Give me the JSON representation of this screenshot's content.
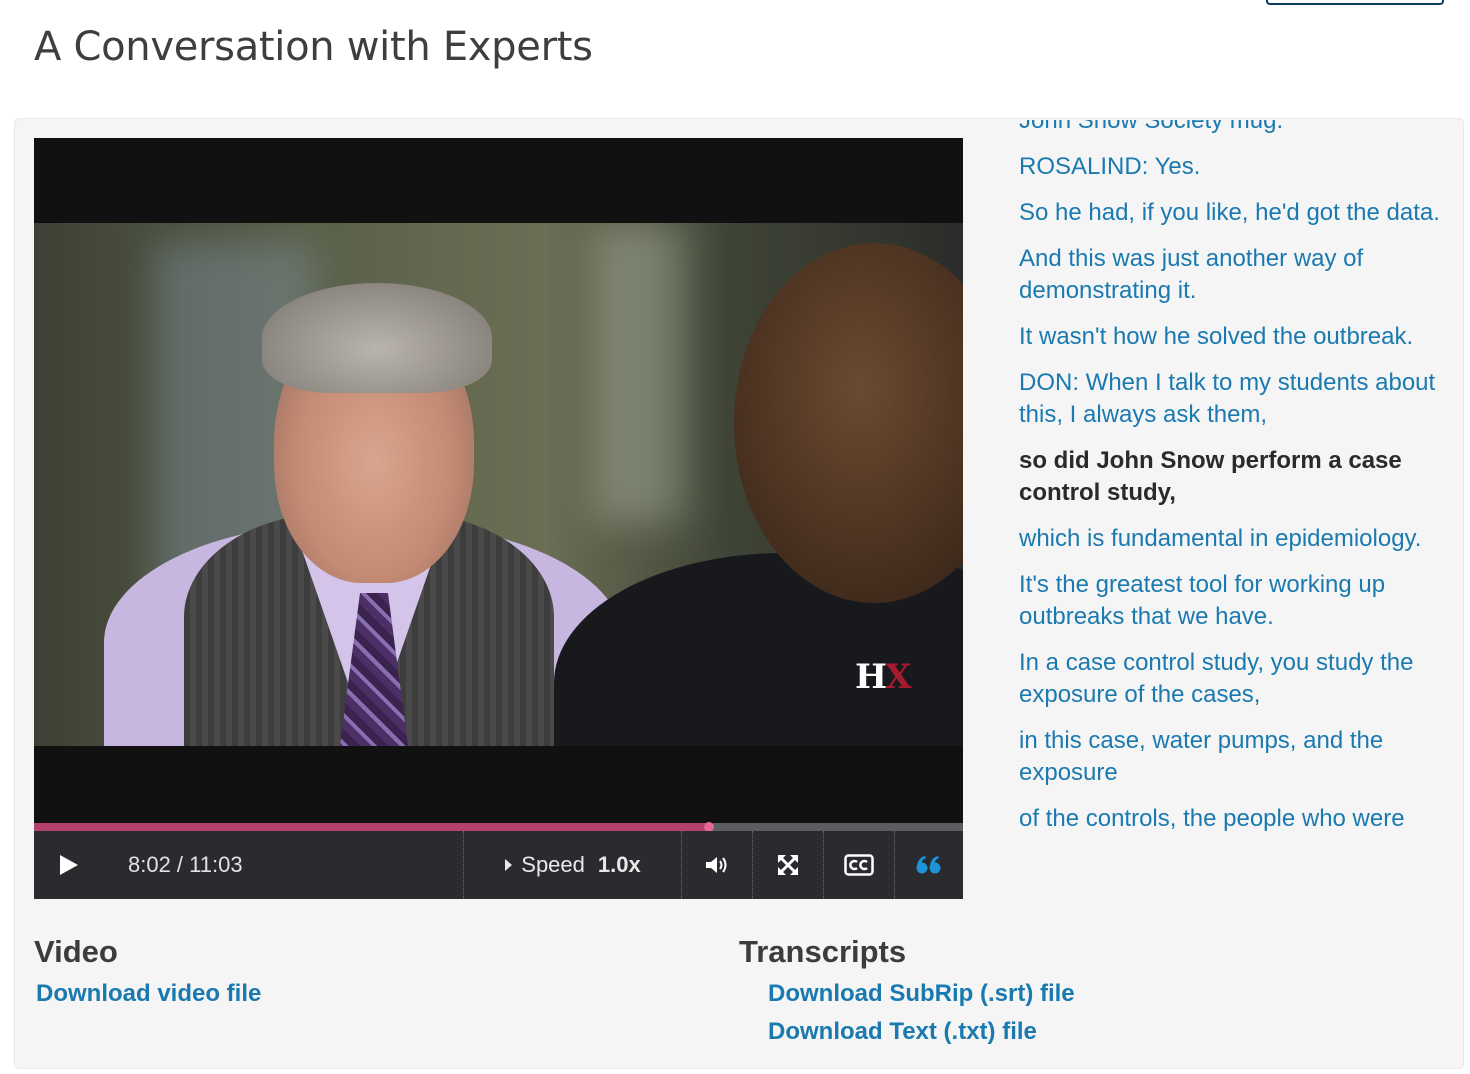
{
  "page": {
    "title": "A Conversation with Experts"
  },
  "player": {
    "logo_h": "H",
    "logo_x": "X",
    "time_display": "8:02 / 11:03",
    "progress_fraction": 0.7263,
    "speed_label": "Speed",
    "speed_value": "1.0x",
    "icons": {
      "play": "play-icon",
      "volume": "volume-icon",
      "fullscreen": "fullscreen-icon",
      "captions": "cc-icon",
      "transcript_toggle": "quote-icon"
    },
    "colors": {
      "progress": "#b2416b",
      "handle": "#e46799",
      "transcript_toggle": "#1e93d8"
    }
  },
  "transcript": {
    "lines": [
      {
        "text": "John Snow Society mug.",
        "active": false
      },
      {
        "text": "ROSALIND: Yes.",
        "active": false
      },
      {
        "text": "So he had, if you like, he'd got the data.",
        "active": false
      },
      {
        "text": "And this was just another way of demonstrating it.",
        "active": false
      },
      {
        "text": "It wasn't how he solved the outbreak.",
        "active": false
      },
      {
        "text": "DON: When I talk to my students about this, I always ask them,",
        "active": false
      },
      {
        "text": "so did John Snow perform a case control study,",
        "active": true
      },
      {
        "text": "which is fundamental in epidemiology.",
        "active": false
      },
      {
        "text": "It's the greatest tool for working up outbreaks that we have.",
        "active": false
      },
      {
        "text": "In a case control study, you study the exposure of the cases,",
        "active": false
      },
      {
        "text": "in this case, water pumps, and the exposure",
        "active": false
      },
      {
        "text": "of the controls, the people who were",
        "active": false
      }
    ],
    "colors": {
      "link": "#1a7ab0",
      "active": "#2a2a2a"
    }
  },
  "downloads": {
    "video_heading": "Video",
    "video_link": "Download video file",
    "transcripts_heading": "Transcripts",
    "srt_link": "Download SubRip (.srt) file",
    "txt_link": "Download Text (.txt) file"
  }
}
